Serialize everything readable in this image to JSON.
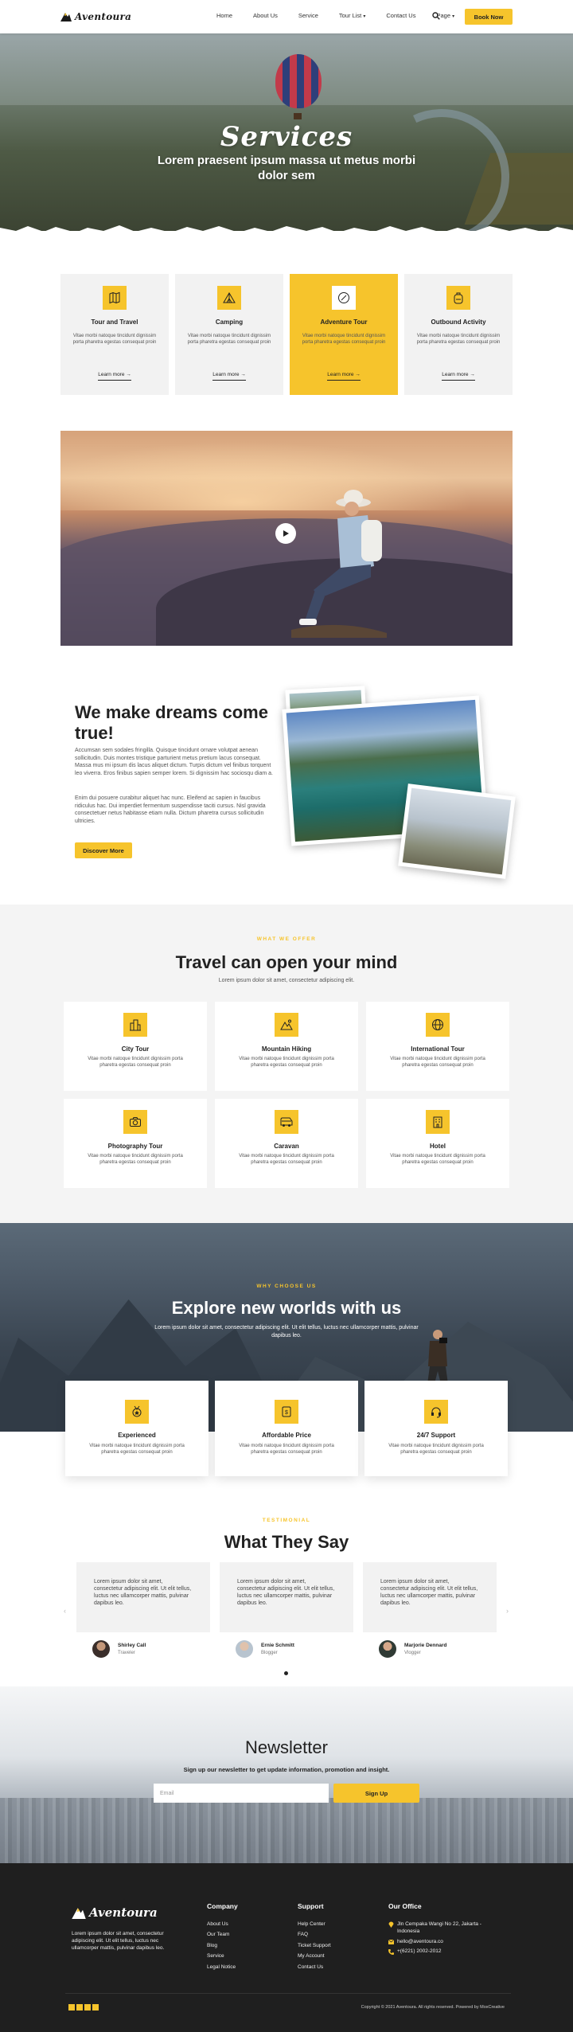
{
  "brand": {
    "name": "Aventoura",
    "accent": "#f6c42c",
    "dark": "#1f1f1f"
  },
  "header": {
    "nav": [
      "Home",
      "About Us",
      "Service",
      "Tour List",
      "Contact Us",
      "Page"
    ],
    "book_label": "Book Now"
  },
  "hero": {
    "title": "Services",
    "subtitle": "Lorem praesent ipsum massa ut metus morbi dolor sem"
  },
  "services": [
    {
      "title": "Tour and Travel",
      "text": "Vitae morbi natoque tincidunt dignissim porta pharetra egestas consequat proin",
      "link": "Learn more →",
      "icon": "map-icon"
    },
    {
      "title": "Camping",
      "text": "Vitae morbi natoque tincidunt dignissim porta pharetra egestas consequat proin",
      "link": "Learn more →",
      "icon": "tent-icon"
    },
    {
      "title": "Adventure Tour",
      "text": "Vitae morbi natoque tincidunt dignissim porta pharetra egestas consequat proin",
      "link": "Learn more →",
      "icon": "compass-icon"
    },
    {
      "title": "Outbound Activity",
      "text": "Vitae morbi natoque tincidunt dignissim porta pharetra egestas consequat proin",
      "link": "Learn more →",
      "icon": "backpack-icon"
    }
  ],
  "dreams": {
    "title": "We make dreams come true!",
    "p1": "Accumsan sem sodales fringilla. Quisque tincidunt ornare volutpat aenean sollicitudin. Duis montes tristique parturient metus pretium lacus consequat. Massa mus mi ipsum dis lacus aliquet dictum. Turpis dictum vel finibus torquent leo viverra. Eros finibus sapien semper lorem. Si dignissim hac sociosqu diam a.",
    "p2": "Enim dui posuere curabitur aliquet hac nunc. Eleifend ac sapien in faucibus ridiculus hac. Dui imperdiet fermentum suspendisse taciti cursus. Nisl gravida consectetuer netus habitasse etiam nulla. Dictum pharetra cursus sollicitudin ultricies.",
    "button": "Discover More"
  },
  "offers": {
    "eyebrow": "WHAT WE OFFER",
    "title": "Travel can open your mind",
    "subtitle": "Lorem ipsum dolor sit amet, consectetur adipiscing elit.",
    "items": [
      {
        "title": "City Tour",
        "text": "Vitae morbi natoque tincidunt dignissim porta pharetra egestas consequat proin",
        "icon": "city-icon"
      },
      {
        "title": "Mountain Hiking",
        "text": "Vitae morbi natoque tincidunt dignissim porta pharetra egestas consequat proin",
        "icon": "mountain-icon"
      },
      {
        "title": "International Tour",
        "text": "Vitae morbi natoque tincidunt dignissim porta pharetra egestas consequat proin",
        "icon": "globe-icon"
      },
      {
        "title": "Photography Tour",
        "text": "Vitae morbi natoque tincidunt dignissim porta pharetra egestas consequat proin",
        "icon": "camera-icon"
      },
      {
        "title": "Caravan",
        "text": "Vitae morbi natoque tincidunt dignissim porta pharetra egestas consequat proin",
        "icon": "van-icon"
      },
      {
        "title": "Hotel",
        "text": "Vitae morbi natoque tincidunt dignissim porta pharetra egestas consequat proin",
        "icon": "hotel-icon"
      }
    ]
  },
  "why": {
    "eyebrow": "WHY CHOOSE US",
    "title": "Explore new worlds with us",
    "subtitle": "Lorem ipsum dolor sit amet, consectetur adipiscing elit. Ut elit tellus, luctus nec ullamcorper mattis, pulvinar dapibus leo.",
    "items": [
      {
        "title": "Experienced",
        "text": "Vitae morbi natoque tincidunt dignissim porta pharetra egestas consequat proin",
        "icon": "medal-icon"
      },
      {
        "title": "Affordable Price",
        "text": "Vitae morbi natoque tincidunt dignissim porta pharetra egestas consequat proin",
        "icon": "price-tag-icon"
      },
      {
        "title": "24/7 Support",
        "text": "Vitae morbi natoque tincidunt dignissim porta pharetra egestas consequat proin",
        "icon": "support-icon"
      }
    ]
  },
  "testimonials": {
    "eyebrow": "TESTIMONIAL",
    "title": "What They Say",
    "items": [
      {
        "text": "Lorem ipsum dolor sit amet, consectetur adipiscing elit. Ut elit tellus, luctus nec ullamcorper mattis, pulvinar dapibus leo.",
        "name": "Shirley Call",
        "role": "Traveler"
      },
      {
        "text": "Lorem ipsum dolor sit amet, consectetur adipiscing elit. Ut elit tellus, luctus nec ullamcorper mattis, pulvinar dapibus leo.",
        "name": "Ernie Schmitt",
        "role": "Blogger"
      },
      {
        "text": "Lorem ipsum dolor sit amet, consectetur adipiscing elit. Ut elit tellus, luctus nec ullamcorper mattis, pulvinar dapibus leo.",
        "name": "Marjorie Dennard",
        "role": "Vlogger"
      }
    ]
  },
  "newsletter": {
    "title": "Newsletter",
    "subtitle": "Sign up our newsletter to get update information, promotion and insight.",
    "placeholder": "Email",
    "button": "Sign Up"
  },
  "footer": {
    "about": "Lorem ipsum dolor sit amet, consectetur adipiscing elit. Ut elit tellus, luctus nec ullamcorper mattis, pulvinar dapibus leo.",
    "company_title": "Company",
    "company": [
      "About Us",
      "Our Team",
      "Blog",
      "Service",
      "Legal Notice"
    ],
    "support_title": "Support",
    "support": [
      "Help Center",
      "FAQ",
      "Ticket Support",
      "My Account",
      "Contact Us"
    ],
    "office_title": "Our Office",
    "address": "Jln Cempaka Wangi No 22, Jakarta - Indonesia",
    "email": "hello@aventoura.co",
    "phone": "+(6221) 2002-2012",
    "copyright": "Copyright © 2021 Aventoura. All rights reserved. Powered by MoxCreative"
  }
}
